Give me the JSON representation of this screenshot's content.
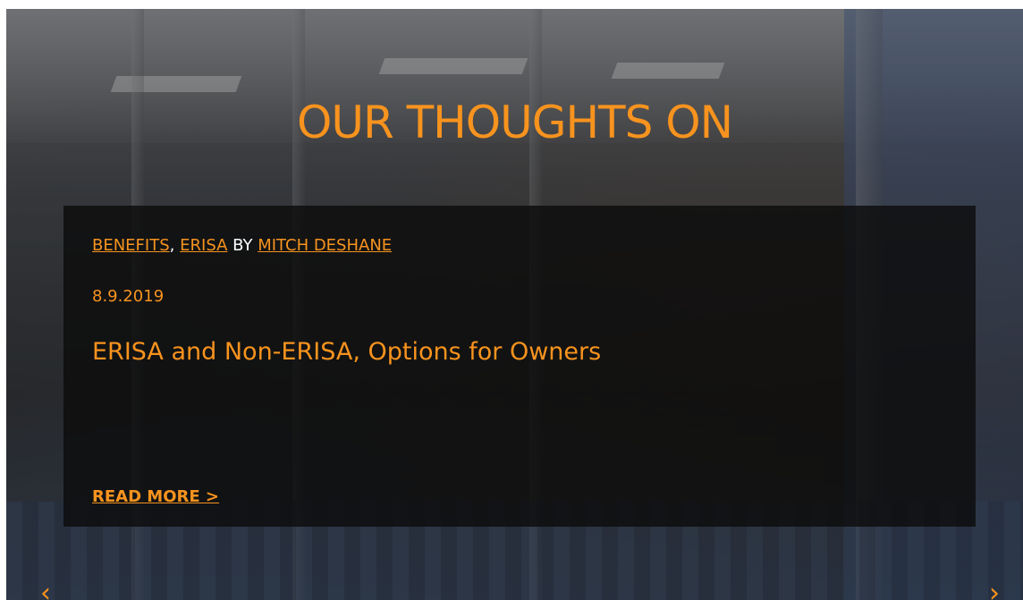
{
  "hero": {
    "heading": "OUR THOUGHTS ON"
  },
  "post": {
    "categories": [
      "BENEFITS",
      "ERISA"
    ],
    "category_separator": ",",
    "by_label": "BY",
    "author": "MITCH DESHANE",
    "date": "8.9.2019",
    "title": "ERISA and Non-ERISA, Options for Owners",
    "read_more_label": "READ MORE >"
  },
  "carousel": {
    "prev_glyph": "‹",
    "next_glyph": "›"
  },
  "colors": {
    "accent": "#f7931e",
    "card_background": "#0c0c0c",
    "meta_text": "#ffffff"
  },
  "icons": {
    "prev": "chevron-left-icon",
    "next": "chevron-right-icon"
  }
}
